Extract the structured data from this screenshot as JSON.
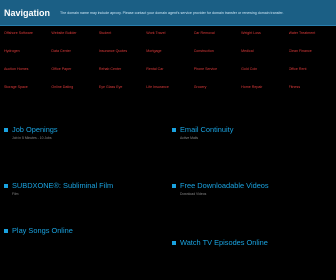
{
  "header": {
    "brand": "Navigation",
    "notice": "The domain name may include aproxy. Please contact your domain agent's service provider for domain transfer or renewing domain transfer."
  },
  "nav": [
    [
      "Offshore Software",
      "Website Builder",
      "Student",
      "Work Travel",
      "Car Removal",
      "Weight Loss",
      "Water Treatment"
    ],
    [
      "Hydrogen",
      "Data Center",
      "Insurance Quotes",
      "Mortgage",
      "Construction",
      "Medical",
      "Clean Finance"
    ],
    [
      "Auction Homes",
      "Office Paper",
      "Rehab Center",
      "Rental Car",
      "Phone Service",
      "Gold Coin",
      "Office Rent"
    ],
    [
      "Storage Space",
      "Online Dating",
      "Eye Glass Eye",
      "Life Insurance",
      "Grocery",
      "Home Repair",
      "Fitness"
    ]
  ],
  "sections": [
    {
      "title": "Job Openings",
      "sub": "Job in 5 Minutes - 10 Jobs"
    },
    {
      "title": "Email Continuity",
      "sub": "Active Mails"
    },
    {
      "title": "SUBDXONE®: Subliminal Film",
      "sub": "Film"
    },
    {
      "title": "Free Downloadable Videos",
      "sub": "Download Videos"
    },
    {
      "title": "Play Songs Online",
      "sub": ""
    },
    {
      "title": "Watch TV Episodes Online",
      "sub": ""
    }
  ]
}
